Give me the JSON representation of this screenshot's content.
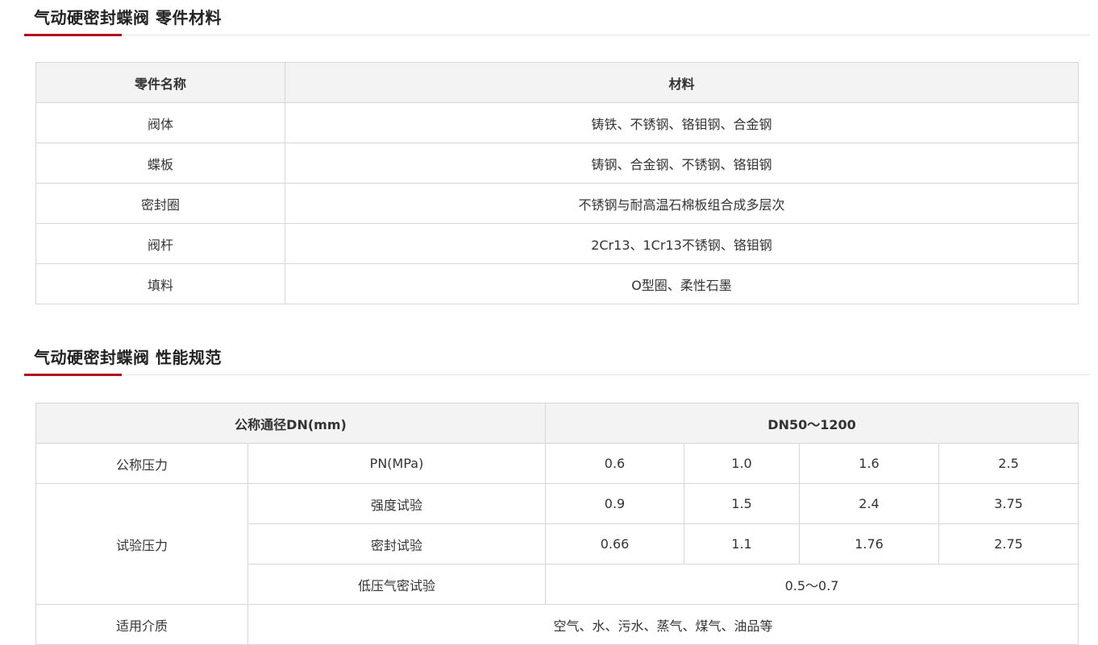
{
  "section1": {
    "title": "气动硬密封蝶阀 零件材料",
    "headers": [
      "零件名称",
      "材料"
    ],
    "rows": [
      [
        "阀体",
        "铸铁、不锈钢、铬钼钢、合金钢"
      ],
      [
        "蝶板",
        "铸钢、合金钢、不锈钢、铬钼钢"
      ],
      [
        "密封圈",
        "不锈钢与耐高温石棉板组合成多层次"
      ],
      [
        "阀杆",
        "2Cr13、1Cr13不锈钢、铬钼钢"
      ],
      [
        "填料",
        "O型圈、柔性石墨"
      ]
    ]
  },
  "section2": {
    "title": "气动硬密封蝶阀 性能规范",
    "header_left": "公称通径DN(mm)",
    "header_right": "DN50～1200",
    "pressure_label": "公称压力",
    "pn_label": "PN(MPa)",
    "pn_values": [
      "0.6",
      "1.0",
      "1.6",
      "2.5"
    ],
    "test_pressure_label": "试验压力",
    "strength_label": "强度试验",
    "strength_values": [
      "0.9",
      "1.5",
      "2.4",
      "3.75"
    ],
    "seal_label": "密封试验",
    "seal_values": [
      "0.66",
      "1.1",
      "1.76",
      "2.75"
    ],
    "low_pressure_label": "低压气密试验",
    "low_pressure_value": "0.5～0.7",
    "medium_label": "适用介质",
    "medium_value": "空气、水、污水、蒸气、煤气、油品等"
  },
  "colors": {
    "accent": "#b0121b",
    "header_bg": "#f3f3f3",
    "border": "#d6d6d6"
  }
}
